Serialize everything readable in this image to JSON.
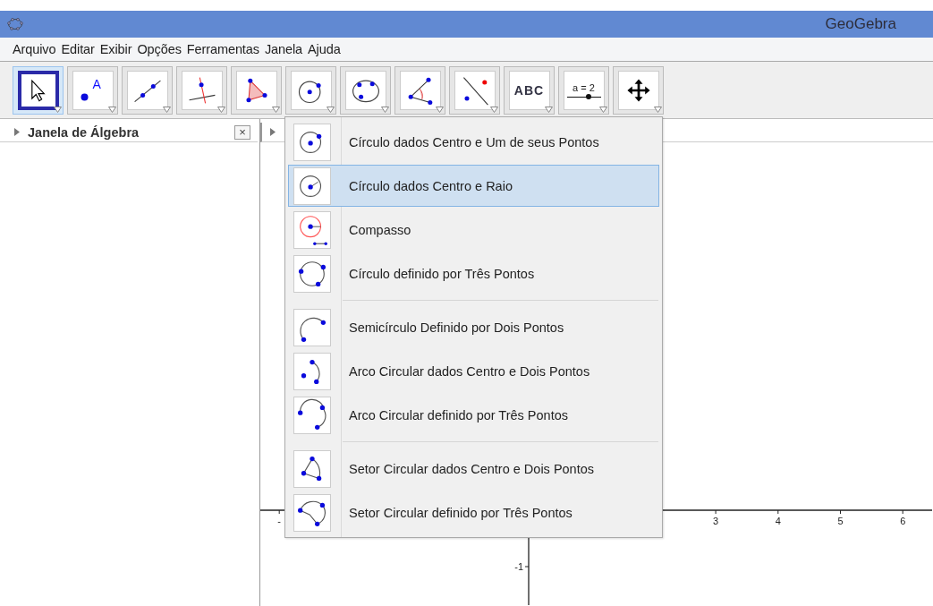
{
  "window": {
    "title": "GeoGebra"
  },
  "menu": [
    "Arquivo",
    "Editar",
    "Exibir",
    "Opções",
    "Ferramentas",
    "Janela",
    "Ajuda"
  ],
  "tools": [
    {
      "kind": "move",
      "selected": true
    },
    {
      "kind": "point",
      "label": "A",
      "selected": false
    },
    {
      "kind": "line",
      "selected": false
    },
    {
      "kind": "perpendicular",
      "selected": false
    },
    {
      "kind": "polygon",
      "selected": false
    },
    {
      "kind": "circle",
      "selected": false
    },
    {
      "kind": "conic",
      "selected": false
    },
    {
      "kind": "angle",
      "selected": false
    },
    {
      "kind": "reflect",
      "selected": false
    },
    {
      "kind": "text",
      "label": "ABC",
      "selected": false
    },
    {
      "kind": "slider",
      "label": "a = 2",
      "selected": false
    },
    {
      "kind": "move-view",
      "selected": false
    }
  ],
  "algebra_view": {
    "title": "Janela de Álgebra",
    "close": "×"
  },
  "dropdown": {
    "groups": [
      [
        {
          "kind": "circle-point",
          "label": "Círculo dados Centro e Um de seus Pontos",
          "selected": false
        },
        {
          "kind": "circle-radius",
          "label": "Círculo dados Centro e Raio",
          "selected": true
        },
        {
          "kind": "compass",
          "label": "Compasso",
          "selected": false
        },
        {
          "kind": "circle-three",
          "label": "Círculo definido por Três Pontos",
          "selected": false
        }
      ],
      [
        {
          "kind": "semicircle",
          "label": "Semicírculo Definido por Dois Pontos",
          "selected": false
        },
        {
          "kind": "arc-center",
          "label": "Arco Circular dados Centro e Dois Pontos",
          "selected": false
        },
        {
          "kind": "arc-three",
          "label": "Arco Circular definido por Três Pontos",
          "selected": false
        }
      ],
      [
        {
          "kind": "sector-center",
          "label": "Setor Circular dados Centro e Dois Pontos",
          "selected": false
        },
        {
          "kind": "sector-three",
          "label": "Setor Circular definido por Três Pontos",
          "selected": false
        }
      ]
    ]
  },
  "graphics": {
    "x_ticks": [
      "-",
      "3",
      "4",
      "5",
      "6"
    ],
    "y_ticks": [
      "-1"
    ]
  }
}
